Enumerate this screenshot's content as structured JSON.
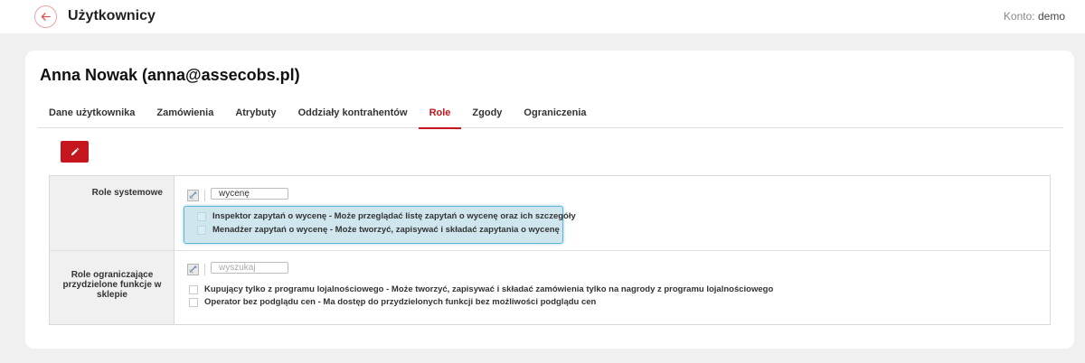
{
  "header": {
    "title": "Użytkownicy",
    "account_label": "Konto:",
    "account_value": "demo"
  },
  "user": {
    "name": "Anna Nowak (anna@assecobs.pl)"
  },
  "tabs": [
    {
      "label": "Dane użytkownika",
      "active": false
    },
    {
      "label": "Zamówienia",
      "active": false
    },
    {
      "label": "Atrybuty",
      "active": false
    },
    {
      "label": "Oddziały kontrahentów",
      "active": false
    },
    {
      "label": "Role",
      "active": true
    },
    {
      "label": "Zgody",
      "active": false
    },
    {
      "label": "Ograniczenia",
      "active": false
    }
  ],
  "colors": {
    "accent": "#c4161c",
    "selection_bg": "#cfe6ee",
    "selection_border": "#62b7d3"
  },
  "roles": {
    "system": {
      "label": "Role systemowe",
      "search_value": "wycenę",
      "options": [
        "Inspektor zapytań o wycenę - Może przeglądać listę zapytań o wycenę oraz ich szczegóły",
        "Menadżer zapytań o wycenę - Może tworzyć, zapisywać i składać zapytania o wycenę"
      ]
    },
    "restricting": {
      "label": "Role ograniczające przydzielone funkcje w sklepie",
      "search_placeholder": "wyszukaj",
      "options": [
        "Kupujący tylko z programu lojalnościowego - Może tworzyć, zapisywać i składać zamówienia tylko na nagrody z programu lojalnościowego",
        "Operator bez podglądu cen - Ma dostęp do przydzielonych funkcji bez możliwości podglądu cen"
      ]
    }
  }
}
